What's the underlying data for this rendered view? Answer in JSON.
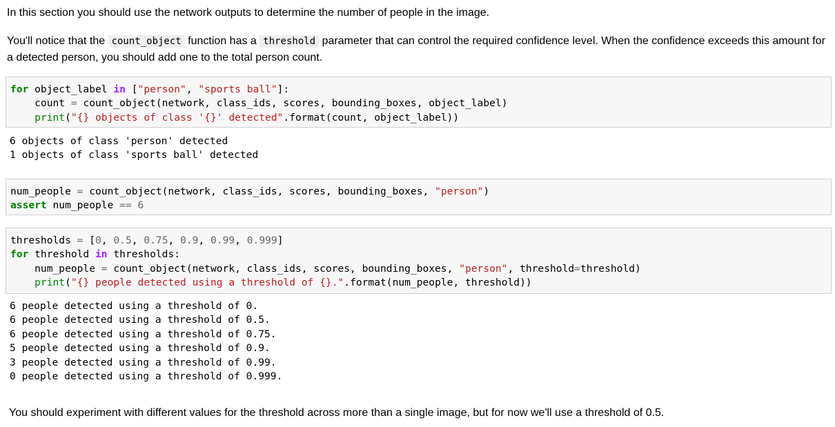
{
  "intro": {
    "p1": "In this section you should use the network outputs to determine the number of people in the image.",
    "p2_a": "You'll notice that the",
    "p2_code1": "count_object",
    "p2_b": "function has a",
    "p2_code2": "threshold",
    "p2_c": "parameter that can control the required confidence level. When the confidence exceeds this amount for a detected person, you should add one to the total person count."
  },
  "cells": [
    {
      "lines": [
        "for object_label in [\"person\", \"sports ball\"]:",
        "    count = count_object(network, class_ids, scores, bounding_boxes, object_label)",
        "    print(\"{} objects of class '{}' detected\".format(count, object_label))"
      ],
      "output": [
        "6 objects of class 'person' detected",
        "1 objects of class 'sports ball' detected"
      ]
    },
    {
      "lines": [
        "num_people = count_object(network, class_ids, scores, bounding_boxes, \"person\")",
        "assert num_people == 6"
      ],
      "output": []
    },
    {
      "lines": [
        "thresholds = [0, 0.5, 0.75, 0.9, 0.99, 0.999]",
        "for threshold in thresholds:",
        "    num_people = count_object(network, class_ids, scores, bounding_boxes, \"person\", threshold=threshold)",
        "    print(\"{} people detected using a threshold of {}.\".format(num_people, threshold))"
      ],
      "output": [
        "6 people detected using a threshold of 0.",
        "6 people detected using a threshold of 0.5.",
        "6 people detected using a threshold of 0.75.",
        "5 people detected using a threshold of 0.9.",
        "3 people detected using a threshold of 0.99.",
        "0 people detected using a threshold of 0.999."
      ]
    }
  ],
  "outro": {
    "text": "You should experiment with different values for the threshold across more than a single image, but for now we'll use a threshold of 0.5."
  },
  "syntax_colors": {
    "keyword": "#008000",
    "in_keyword": "#aa22ff",
    "string": "#ba2121",
    "operator": "#666666",
    "number": "#666666",
    "cell_background": "#f7f7f7",
    "cell_border": "#cfcfcf"
  }
}
